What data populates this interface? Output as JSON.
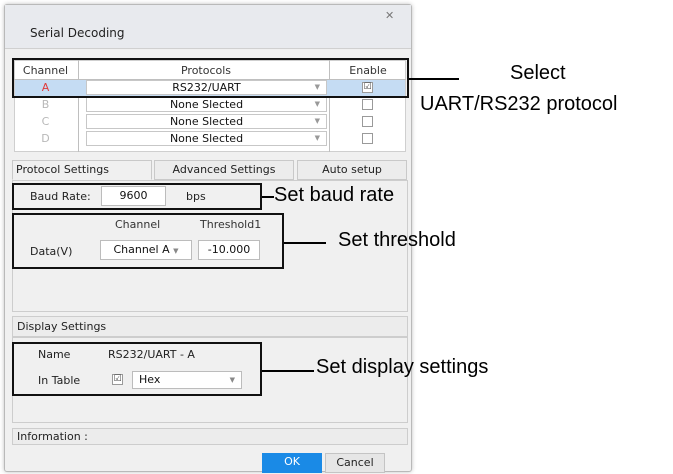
{
  "dialog": {
    "title": "Serial Decoding",
    "close_symbol": "✕"
  },
  "channel_table": {
    "headers": {
      "channel": "Channel",
      "protocols": "Protocols",
      "enable": "Enable"
    },
    "rows": [
      {
        "channel": "A",
        "protocol": "RS232/UART",
        "enabled": true,
        "check": "☑"
      },
      {
        "channel": "B",
        "protocol": "None Slected",
        "enabled": false,
        "check": ""
      },
      {
        "channel": "C",
        "protocol": "None Slected",
        "enabled": false,
        "check": ""
      },
      {
        "channel": "D",
        "protocol": "None Slected",
        "enabled": false,
        "check": ""
      }
    ],
    "dropdown_arrow": "▼"
  },
  "tabs": {
    "protocol_settings": "Protocol Settings",
    "advanced_settings": "Advanced Settings",
    "auto_setup": "Auto setup"
  },
  "protocol": {
    "baud_rate_label": "Baud Rate:",
    "baud_rate_value": "9600",
    "baud_unit": "bps",
    "channel_header": "Channel",
    "threshold_header": "Threshold1",
    "data_label": "Data(V)",
    "data_channel": "Channel A",
    "threshold_value": "-10.000"
  },
  "display_settings": {
    "section_title": "Display Settings",
    "name_label": "Name",
    "name_value": "RS232/UART - A",
    "in_table_label": "In Table",
    "in_table_check": "☑",
    "format": "Hex"
  },
  "information": {
    "label": "Information :"
  },
  "buttons": {
    "ok": "OK",
    "cancel": "Cancel"
  },
  "callouts": {
    "select_line1": "Select",
    "select_line2": "UART/RS232 protocol",
    "baud": "Set baud rate",
    "threshold": "Set threshold",
    "display": "Set display settings"
  },
  "colors": {
    "selected_row": "#c5dcf3",
    "channel_a": "#e03a3a",
    "ok_button": "#1a8ae6",
    "annotation_box": "#111111"
  }
}
